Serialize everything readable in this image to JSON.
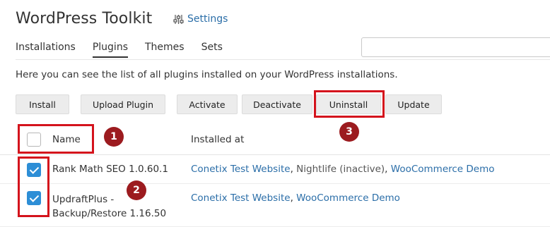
{
  "header": {
    "title": "WordPress Toolkit",
    "settings_label": "Settings"
  },
  "tabs": [
    {
      "label": "Installations",
      "active": false
    },
    {
      "label": "Plugins",
      "active": true
    },
    {
      "label": "Themes",
      "active": false
    },
    {
      "label": "Sets",
      "active": false
    }
  ],
  "search": {
    "value": "",
    "placeholder": ""
  },
  "description": "Here you can see the list of all plugins installed on your WordPress installations.",
  "toolbar": {
    "install": "Install",
    "upload_plugin": "Upload Plugin",
    "activate": "Activate",
    "deactivate": "Deactivate",
    "uninstall": "Uninstall",
    "update": "Update"
  },
  "table": {
    "columns": [
      "Name",
      "Installed at"
    ],
    "rows": [
      {
        "checked": true,
        "name": "Rank Math SEO 1.0.60.1",
        "installs": [
          {
            "text": "Conetix Test Website",
            "link": true
          },
          {
            "text": ", ",
            "link": false
          },
          {
            "text": "Nightlife (inactive)",
            "link": false
          },
          {
            "text": ", ",
            "link": false
          },
          {
            "text": "WooCommerce Demo",
            "link": true
          }
        ]
      },
      {
        "checked": true,
        "name_line1": "UpdraftPlus -",
        "name_line2": "Backup/Restore 1.16.50",
        "installs": [
          {
            "text": "Conetix Test Website",
            "link": true
          },
          {
            "text": ", ",
            "link": false
          },
          {
            "text": "WooCommerce Demo",
            "link": true
          }
        ]
      }
    ]
  },
  "annotations": {
    "badge1": "1",
    "badge2": "2",
    "badge3": "3",
    "color": "#d4131c",
    "badge_color": "#9c1b1f"
  },
  "colors": {
    "link": "#2b6ea8",
    "checkbox": "#2d8ed6",
    "button_bg": "#ececec"
  }
}
